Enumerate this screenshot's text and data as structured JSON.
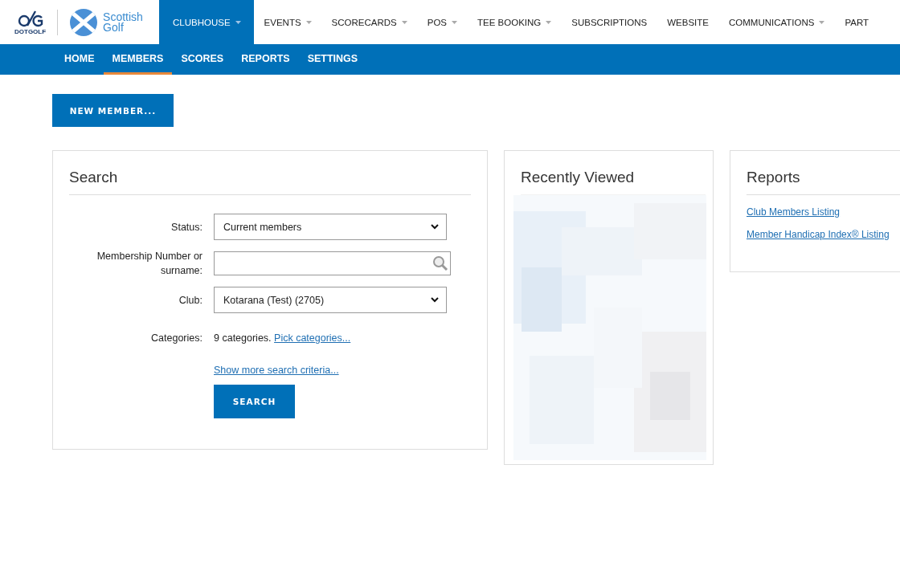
{
  "logo": {
    "brand": "DOTGOLF",
    "partner": "Scottish Golf"
  },
  "main_nav": [
    {
      "label": "CLUBHOUSE",
      "selected": true,
      "dropdown": true
    },
    {
      "label": "EVENTS",
      "selected": false,
      "dropdown": true
    },
    {
      "label": "SCORECARDS",
      "selected": false,
      "dropdown": true
    },
    {
      "label": "POS",
      "selected": false,
      "dropdown": true
    },
    {
      "label": "TEE BOOKING",
      "selected": false,
      "dropdown": true
    },
    {
      "label": "SUBSCRIPTIONS",
      "selected": false,
      "dropdown": false
    },
    {
      "label": "WEBSITE",
      "selected": false,
      "dropdown": false
    },
    {
      "label": "COMMUNICATIONS",
      "selected": false,
      "dropdown": true
    },
    {
      "label": "PART",
      "selected": false,
      "dropdown": false
    }
  ],
  "sub_nav": [
    {
      "label": "HOME",
      "selected": false
    },
    {
      "label": "MEMBERS",
      "selected": true
    },
    {
      "label": "SCORES",
      "selected": false
    },
    {
      "label": "REPORTS",
      "selected": false
    },
    {
      "label": "SETTINGS",
      "selected": false
    }
  ],
  "new_member_button": "NEW MEMBER...",
  "search": {
    "title": "Search",
    "status": {
      "label": "Status:",
      "value": "Current members"
    },
    "membership": {
      "label": "Membership Number or surname:"
    },
    "club": {
      "label": "Club:",
      "value": "Kotarana (Test) (2705)"
    },
    "categories": {
      "label": "Categories:",
      "summary": "9 categories.",
      "link": "Pick categories..."
    },
    "more_link": "Show more search criteria...",
    "button": "SEARCH"
  },
  "recently_viewed": {
    "title": "Recently Viewed"
  },
  "reports": {
    "title": "Reports",
    "links": [
      "Club Members Listing",
      "Member Handicap Index® Listing"
    ]
  }
}
